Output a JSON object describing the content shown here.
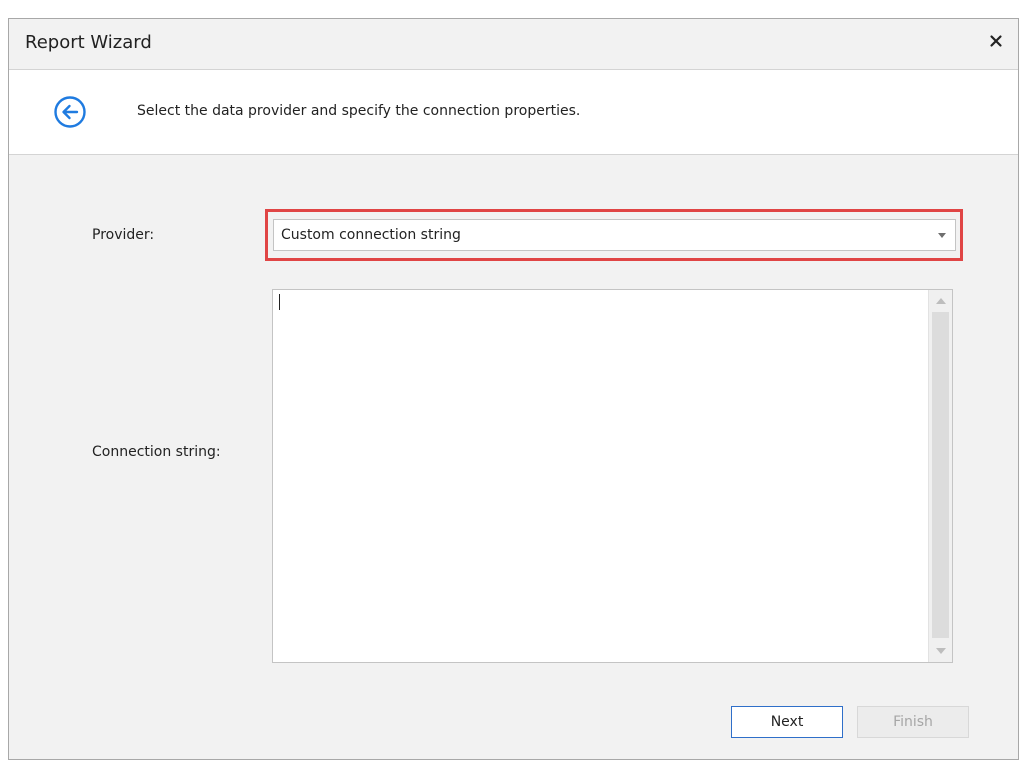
{
  "window": {
    "title": "Report Wizard"
  },
  "header": {
    "instruction": "Select the data provider and specify the connection properties."
  },
  "form": {
    "provider_label": "Provider:",
    "provider_value": "Custom connection string",
    "connection_label": "Connection string:",
    "connection_value": ""
  },
  "buttons": {
    "next": "Next",
    "finish": "Finish"
  },
  "colors": {
    "accent": "#1f7be0",
    "highlight": "#e04545",
    "button_border": "#2f6fc9",
    "disabled_text": "#a6a6a6"
  },
  "icons": {
    "close": "close-icon",
    "back": "back-arrow-circle-icon",
    "dropdown": "chevron-down-icon",
    "scroll_up": "scroll-up-arrow-icon",
    "scroll_down": "scroll-down-arrow-icon"
  }
}
